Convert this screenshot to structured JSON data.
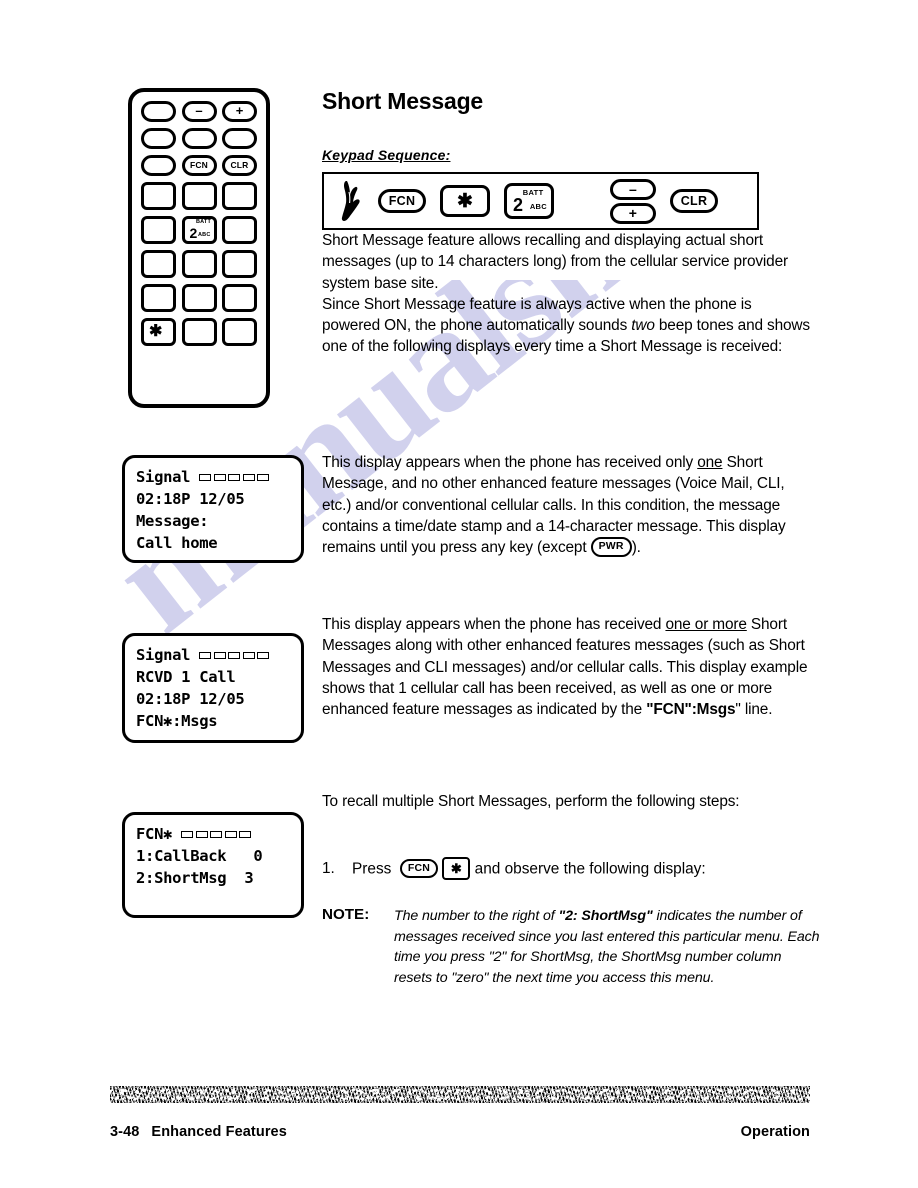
{
  "watermark": {
    "text": "manualsnet.com",
    "color": "#c9c9ea"
  },
  "section": {
    "title": "Short Message",
    "keypad_sequence_label": "Keypad Sequence:"
  },
  "keypad_illustration": {
    "name": "phone-keypad-diagram",
    "keys": {
      "minus": "–",
      "plus": "+",
      "fcn": "FCN",
      "clr": "CLR",
      "two_top": "BATT",
      "two_num": "2",
      "two_right": "ABC",
      "star": "✱"
    }
  },
  "keypad_sequence": {
    "hand_icon": "pointing-hand-icon",
    "steps": [
      {
        "label": "FCN",
        "shape": "pill"
      },
      {
        "label": "✱",
        "shape": "square"
      },
      {
        "label": "2",
        "shape": "square-two",
        "top": "BATT",
        "right": "ABC"
      },
      {
        "label": "–",
        "shape": "pill"
      },
      {
        "label": "+",
        "shape": "pill"
      },
      {
        "label": "CLR",
        "shape": "pill"
      }
    ]
  },
  "paragraphs": {
    "intro": "Short Message feature allows recalling and displaying actual short messages (up to 14 characters long) from the cellular service provider system base site.",
    "since_a": "Since Short Message feature is always active when the phone is powered ON, the phone automatically sounds ",
    "since_two": "two",
    "since_b": " beep tones and shows one of the following displays every time a Short Message is received:",
    "display1_a": "This display appears when the phone has received only ",
    "display1_one": "one",
    "display1_b": " Short Message, and no other enhanced feature messages (Voice Mail, CLI, etc.) and/or conventional cellular calls.  In this condition, the message contains a time/date stamp and a 14-character message.  This display remains until you press any key (except ",
    "display1_pwr": "PWR",
    "display1_c": ").",
    "display2_a": "This display appears when the phone has received ",
    "display2_oneor": "one or more",
    "display2_b": " Short Messages along with other enhanced features messages (such as Short Messages and CLI messages) and/or cellular calls.  This display example shows that 1 cellular call has been received, as well as one or more enhanced feature messages as indicated by the ",
    "display2_fcn": "\"FCN\":Msgs",
    "display2_c": "\" line.",
    "recall": "To recall multiple Short Messages, perform the following steps:"
  },
  "step": {
    "number": "1.",
    "press_word": "Press",
    "key_fcn": "FCN",
    "key_star": "✱",
    "tail": "and observe the following display:"
  },
  "note": {
    "label": "NOTE:",
    "text_a": "The number to the right of ",
    "text_bold": "\"2: ShortMsg\"",
    "text_b": " indicates the number of messages received since you last entered this particular menu.  Each time you press \"2\" for ShortMsg, the ShortMsg number column resets to \"zero\" the next time you access this menu."
  },
  "displays": [
    {
      "id": "display-one-short-message",
      "line1": "Signal",
      "signal_bars": 5,
      "line2": "02:18P 12/05",
      "line3": "Message:",
      "line4": "Call home"
    },
    {
      "id": "display-one-or-more-messages",
      "line1": "Signal",
      "signal_bars": 5,
      "line2": "RCVD 1 Call",
      "line3": "02:18P 12/05",
      "line4": "FCN✱:Msgs"
    },
    {
      "id": "display-msgs-menu",
      "line1": "FCN✱",
      "signal_bars": 5,
      "line2": "1:CallBack   0",
      "line3": "2:ShortMsg  3",
      "line4": ""
    }
  ],
  "footer": {
    "page_number": "3-48",
    "chapter": "Enhanced Features",
    "section_right": "Operation"
  }
}
